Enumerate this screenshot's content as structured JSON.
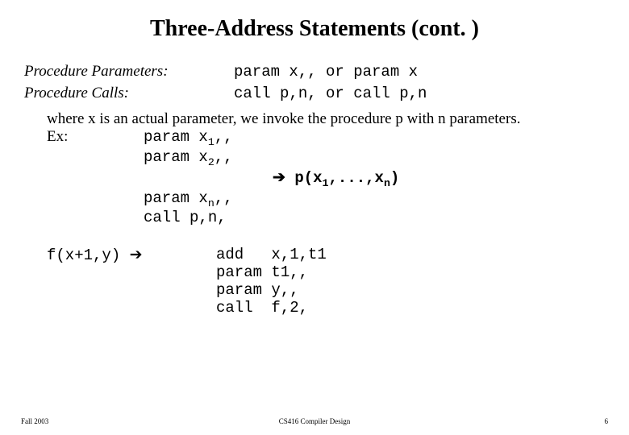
{
  "title": "Three-Address Statements (cont. )",
  "defs": {
    "param_label": "Procedure Parameters:",
    "param_code": "param x,,  or  param x",
    "call_label": "Procedure Calls:",
    "call_code": "call p,n,  or  call p,n"
  },
  "where_text": "where x is an actual parameter, we invoke the procedure p with n parameters.",
  "ex_label": "Ex:",
  "ex_lines": {
    "l1_pre": "param x",
    "l1_sub": "1",
    "l1_post": ",,",
    "l2_pre": "param x",
    "l2_sub": "2",
    "l2_post": ",,",
    "arrow": "➔",
    "impl_pre": "  p(x",
    "impl_sub1": "1",
    "impl_mid": ",...,x",
    "impl_sub2": "n",
    "impl_post": ")",
    "l3_pre": "param x",
    "l3_sub": "n",
    "l3_post": ",,",
    "l4": "call  p,n,"
  },
  "fcall": {
    "left_pre": "f(x+1,y) ",
    "arrow": "➔",
    "r1": "add   x,1,t1",
    "r2": "param t1,,",
    "r3": "param y,,",
    "r4": "call  f,2,"
  },
  "footer": {
    "left": "Fall 2003",
    "center": "CS416 Compiler Design",
    "right": "6"
  }
}
